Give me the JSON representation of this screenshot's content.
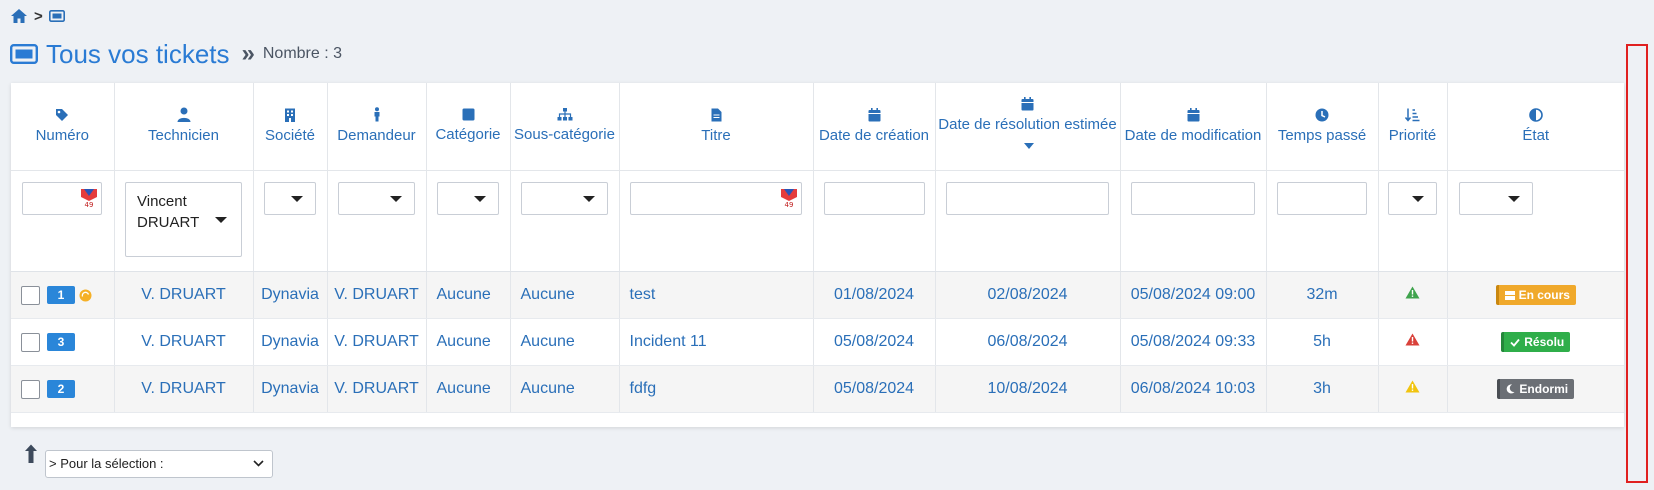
{
  "breadcrumb": {
    "separator": ">"
  },
  "header": {
    "title": "Tous vos tickets",
    "separator": "»",
    "count_label": "Nombre : 3"
  },
  "columns": [
    {
      "key": "numero",
      "label": "Numéro",
      "icon": "tag-icon"
    },
    {
      "key": "technicien",
      "label": "Technicien",
      "icon": "user-icon"
    },
    {
      "key": "societe",
      "label": "Société",
      "icon": "building-icon"
    },
    {
      "key": "demandeur",
      "label": "Demandeur",
      "icon": "person-icon"
    },
    {
      "key": "categorie",
      "label": "Catégorie",
      "icon": "square-icon"
    },
    {
      "key": "sous_categorie",
      "label": "Sous-catégorie",
      "icon": "sitemap-icon"
    },
    {
      "key": "titre",
      "label": "Titre",
      "icon": "file-icon"
    },
    {
      "key": "date_creation",
      "label": "Date de création",
      "icon": "calendar-icon"
    },
    {
      "key": "date_resolution",
      "label": "Date de résolution estimée",
      "icon": "calendar-icon"
    },
    {
      "key": "date_modification",
      "label": "Date de modification",
      "icon": "calendar-icon"
    },
    {
      "key": "temps_passe",
      "label": "Temps passé",
      "icon": "clock-icon"
    },
    {
      "key": "priorite",
      "label": "Priorité",
      "icon": "sort-icon"
    },
    {
      "key": "etat",
      "label": "État",
      "icon": "contrast-icon"
    }
  ],
  "filters": {
    "technicien_value": "Vincent DRUART",
    "badge_text": "49"
  },
  "rows": [
    {
      "id": "1",
      "technicien": "V. DRUART",
      "societe": "Dynavia",
      "demandeur": "V. DRUART",
      "categorie": "Aucune",
      "sous_categorie": "Aucune",
      "titre": "test",
      "date_creation": "01/08/2024",
      "date_resolution": "02/08/2024",
      "date_modification": "05/08/2024 09:00",
      "temps_passe": "32m",
      "priorite_color": "#3fa34d",
      "etat": "En cours"
    },
    {
      "id": "3",
      "technicien": "V. DRUART",
      "societe": "Dynavia",
      "demandeur": "V. DRUART",
      "categorie": "Aucune",
      "sous_categorie": "Aucune",
      "titre": "Incident 11",
      "date_creation": "05/08/2024",
      "date_resolution": "06/08/2024",
      "date_modification": "05/08/2024 09:33",
      "temps_passe": "5h",
      "priorite_color": "#d9413a",
      "etat": "Résolu"
    },
    {
      "id": "2",
      "technicien": "V. DRUART",
      "societe": "Dynavia",
      "demandeur": "V. DRUART",
      "categorie": "Aucune",
      "sous_categorie": "Aucune",
      "titre": "fdfg",
      "date_creation": "05/08/2024",
      "date_resolution": "10/08/2024",
      "date_modification": "06/08/2024 10:03",
      "temps_passe": "3h",
      "priorite_color": "#f1c40f",
      "etat": "Endormi"
    }
  ],
  "bulk_action": {
    "selected": "> Pour la sélection :"
  },
  "colors": {
    "accent": "#2a6fb8",
    "title": "#2a7bd4",
    "highlight": "#e02020"
  }
}
